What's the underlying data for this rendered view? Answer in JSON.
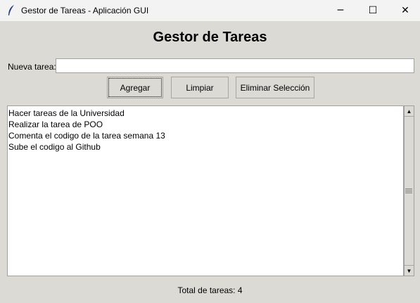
{
  "window": {
    "title": "Gestor de Tareas - Aplicación GUI"
  },
  "header": {
    "title": "Gestor de Tareas"
  },
  "form": {
    "label": "Nueva tarea:",
    "value": ""
  },
  "buttons": {
    "add": "Agregar",
    "clear": "Limpiar",
    "delete": "Eliminar Selección"
  },
  "tasks": [
    "Hacer tareas de la Universidad",
    "Realizar la tarea de POO",
    "Comenta el codigo de la tarea semana 13",
    "Sube el codigo al Github"
  ],
  "status": "Total de tareas: 4"
}
